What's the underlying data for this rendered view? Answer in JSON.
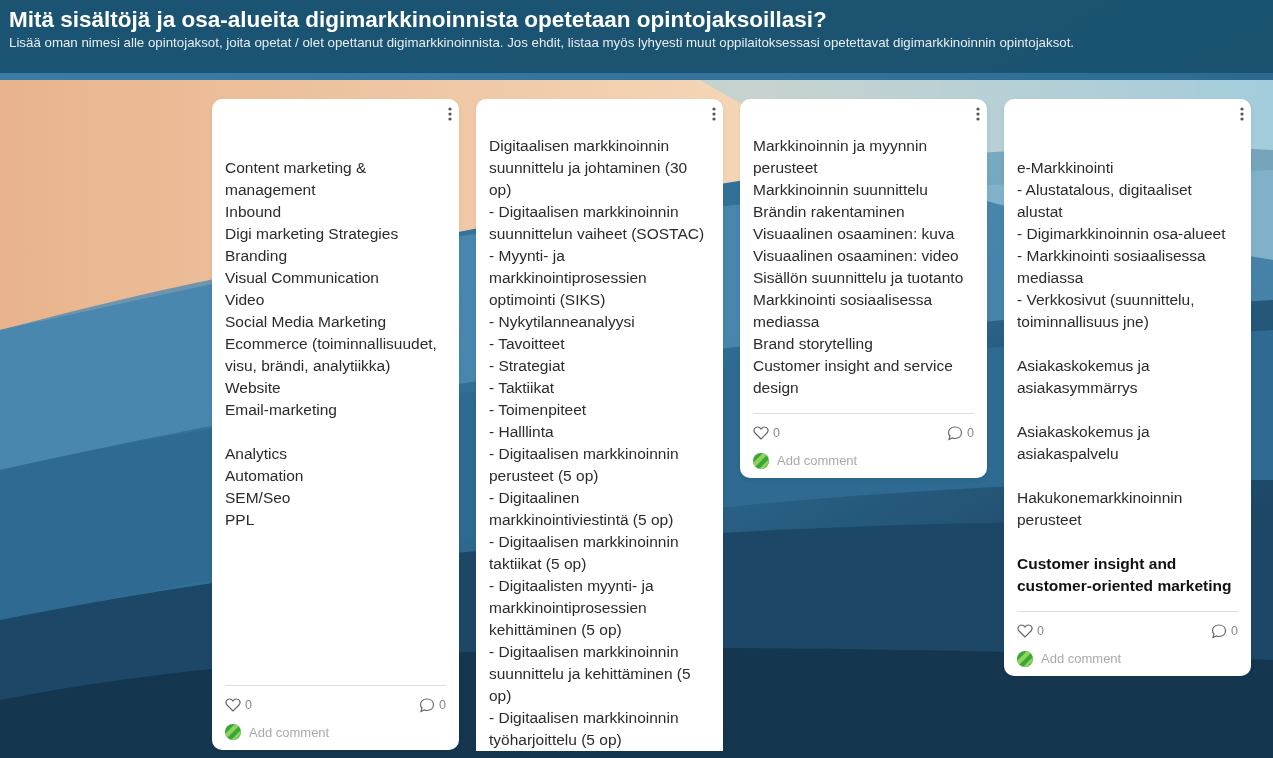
{
  "header": {
    "title": "Mitä sisältöjä ja osa-alueita digimarkkinoinnista opetetaan opintojaksoillasi?",
    "subtitle": "Lisää oman nimesi alle opintojaksot, joita opetat / olet opettanut digimarkkinoinnista. Jos ehdit, listaa myös lyhyesti muut oppilaitoksessasi opetettavat digimarkkinoinnin opintojaksot."
  },
  "posts": [
    {
      "gap_before": true,
      "blocks": [
        {
          "bold": false,
          "lines": [
            "Content marketing & management",
            "Inbound",
            "Digi marketing Strategies",
            "Branding",
            "Visual Communication",
            "Video",
            "Social Media Marketing",
            "Ecommerce (toiminnallisuudet, visu, brändi, analytiikka)",
            "Website",
            "Email-marketing"
          ]
        },
        {
          "bold": false,
          "lines": [
            "Analytics",
            "Automation",
            "SEM/Seo",
            "PPL"
          ]
        }
      ],
      "likes": "0",
      "comments": "0",
      "add_comment": "Add comment"
    },
    {
      "gap_before": false,
      "blocks": [
        {
          "bold": false,
          "lines": [
            "Digitaalisen markkinoinnin suunnittelu ja johtaminen (30 op)",
            "- Digitaalisen markkinoinnin suunnittelun vaiheet (SOSTAC)",
            "- Myynti- ja markkinointiprosessien optimointi (SIKS)",
            "- Nykytilanneanalyysi",
            "- Tavoitteet",
            "- Strategiat",
            "- Taktiikat",
            "- Toimenpiteet",
            "- Halllinta",
            "- Digitaalisen markkinoinnin perusteet (5 op)",
            "- Digitaalinen markkinointiviestintä (5 op)",
            "- Digitaalisen markkinoinnin taktiikat (5 op)",
            "- Digitaalisten myynti- ja markkinointiprosessien kehittäminen (5 op)",
            "- Digitaalisen markkinoinnin suunnittelu ja kehittäminen (5 op)",
            "- Digitaalisen markkinoinnin työharjoittelu (5 op)"
          ]
        }
      ]
    },
    {
      "gap_before": false,
      "blocks": [
        {
          "bold": false,
          "lines": [
            "Markkinoinnin ja myynnin perusteet",
            "Markkinoinnin suunnittelu",
            "Brändin rakentaminen",
            "Visuaalinen osaaminen: kuva",
            "Visuaalinen osaaminen: video",
            "Sisällön suunnittelu ja tuotanto",
            "Markkinointi sosiaalisessa mediassa",
            "Brand storytelling",
            "Customer insight and service design"
          ]
        }
      ],
      "likes": "0",
      "comments": "0",
      "add_comment": "Add comment"
    },
    {
      "gap_before": true,
      "blocks": [
        {
          "bold": false,
          "lines": [
            "e-Markkinointi",
            "- Alustatalous, digitaaliset alustat",
            "- Digimarkkinoinnin osa-alueet",
            "- Markkinointi sosiaalisessa mediassa",
            "- Verkkosivut (suunnittelu, toiminnallisuus jne)"
          ]
        },
        {
          "bold": false,
          "lines": [
            "Asiakaskokemus ja asiakasymmärrys"
          ]
        },
        {
          "bold": false,
          "lines": [
            "Asiakaskokemus ja asiakaspalvelu"
          ]
        },
        {
          "bold": false,
          "lines": [
            "Hakukonemarkkinoinnin perusteet"
          ]
        },
        {
          "bold": true,
          "lines": [
            "Customer insight and customer-oriented marketing"
          ]
        }
      ],
      "likes": "0",
      "comments": "0",
      "add_comment": "Add comment"
    }
  ]
}
